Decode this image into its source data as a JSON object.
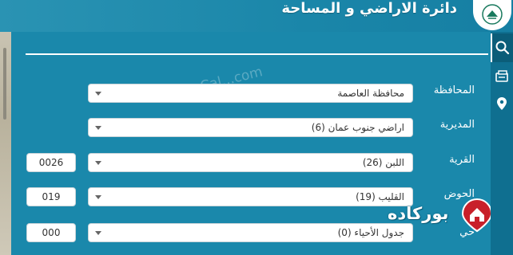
{
  "header": {
    "title": "دائرة الاراضي و المساحة"
  },
  "watermark": "www.Cal...com",
  "form": {
    "rows": [
      {
        "label": "المحافظة",
        "select": "محافظة العاصمة",
        "code": ""
      },
      {
        "label": "المديرية",
        "select": "اراضي جنوب عمان (6)",
        "code": ""
      },
      {
        "label": "القرية",
        "select": "اللبن (26)",
        "code": "0026"
      },
      {
        "label": "الحوض",
        "select": "القليب (19)",
        "code": "019"
      },
      {
        "label": "حي",
        "select": "جدول الأحياء (0)",
        "code": "000"
      }
    ]
  },
  "brand": {
    "text": "بوركاده"
  },
  "rail": {
    "icons": [
      "search-icon",
      "layers-icon",
      "location-pin-icon"
    ]
  },
  "colors": {
    "panel": "#1a88ab",
    "rail": "#0f6f90",
    "accent_white": "#ffffff",
    "brand_red": "#c8202a"
  }
}
